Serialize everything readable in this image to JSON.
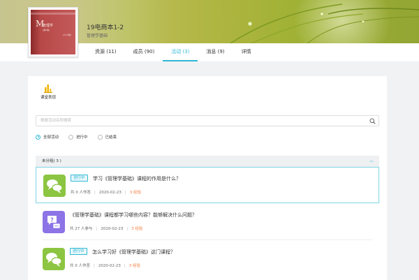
{
  "course": {
    "title": "19电商本1-2",
    "subtitle": "管理学基础",
    "cover": {
      "initial": "M",
      "book_title": "管理学",
      "volume": "(第6版)",
      "edition": "(13.5版)"
    }
  },
  "tabs": [
    {
      "label": "资源 (11)",
      "active": false
    },
    {
      "label": "成员 (90)",
      "active": false
    },
    {
      "label": "活动 (3)",
      "active": true
    },
    {
      "label": "消息 (9)",
      "active": false
    },
    {
      "label": "详情",
      "active": false
    }
  ],
  "toolbar": {
    "course_show_label": "课堂表现",
    "course_show_icon": "bar-chart-icon"
  },
  "search": {
    "placeholder": "根据活动名称搜索"
  },
  "filters": [
    {
      "label": "全部活动",
      "selected": true
    },
    {
      "label": "进行中",
      "selected": false
    },
    {
      "label": "已结束",
      "selected": false
    }
  ],
  "group": {
    "label": "未分组( 3 )"
  },
  "activities": [
    {
      "status": "进行中",
      "title": "学习《管理学基础》课程的作用是什么？",
      "participants": "共 0 人作答",
      "date": "2020-02-23",
      "exp": "3 经验",
      "icon": "chat-bubbles-icon",
      "icon_color": "#8cc541"
    },
    {
      "status": "",
      "title": "《管理学基础》课程都学习哪些内容？能够解决什么问题？",
      "participants": "共 27 人参与",
      "date": "2020-02-23",
      "exp": "3 经验",
      "icon": "qa-icon",
      "icon_color": "#8c73e6"
    },
    {
      "status": "进行中",
      "title": "怎么学习好《管理学基础》这门课程？",
      "participants": "共 0 人作答",
      "date": "2020-02-23",
      "exp": "3 经验",
      "icon": "chat-bubbles-icon",
      "icon_color": "#8cc541"
    }
  ],
  "colors": {
    "accent": "#2fb8d5",
    "exp": "#f07a3a",
    "discussion_icon": "#8cc541",
    "qa_icon": "#8c73e6"
  }
}
